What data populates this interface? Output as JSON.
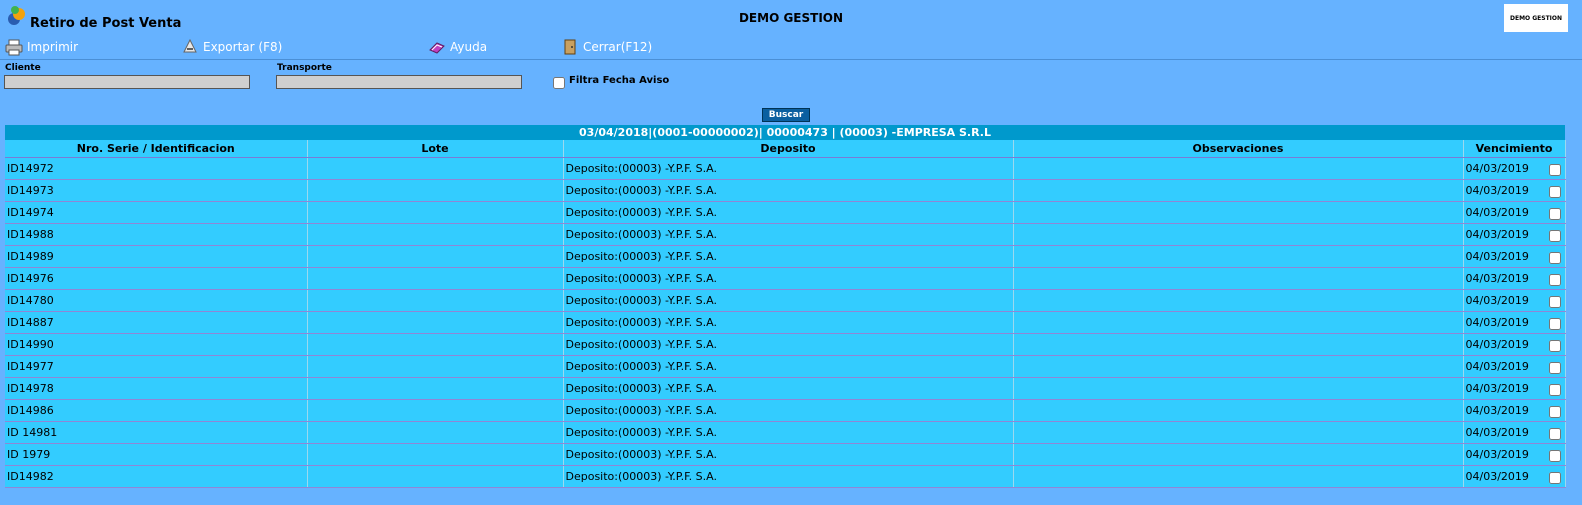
{
  "app": {
    "title": "Retiro de Post Venta",
    "center_title": "DEMO GESTION",
    "brand_label": "DEMO GESTION"
  },
  "toolbar": {
    "items": [
      {
        "label": "Imprimir",
        "icon": "printer-icon"
      },
      {
        "label": "Exportar (F8)",
        "icon": "export-icon"
      },
      {
        "label": "Ayuda",
        "icon": "help-book-icon"
      },
      {
        "label": "Cerrar(F12)",
        "icon": "close-door-icon"
      }
    ]
  },
  "filters": {
    "cliente_label": "Cliente",
    "cliente_value": "",
    "transporte_label": "Transporte",
    "transporte_value": "",
    "filtra_fecha_label": "Filtra Fecha Aviso",
    "filtra_fecha_checked": false,
    "buscar_label": "Buscar"
  },
  "group_header": "03/04/2018|(0001-00000002)| 00000473 | (00003) -EMPRESA S.R.L",
  "table": {
    "columns": [
      "Nro. Serie / Identificacion",
      "Lote",
      "Deposito",
      "Observaciones",
      "Vencimiento"
    ],
    "rows": [
      {
        "serie": "ID14972",
        "lote": "",
        "deposito": "Deposito:(00003) -Y.P.F. S.A.",
        "obs": "",
        "venc": "04/03/2019",
        "checked": false
      },
      {
        "serie": "ID14973",
        "lote": "",
        "deposito": "Deposito:(00003) -Y.P.F. S.A.",
        "obs": "",
        "venc": "04/03/2019",
        "checked": false
      },
      {
        "serie": "ID14974",
        "lote": "",
        "deposito": "Deposito:(00003) -Y.P.F. S.A.",
        "obs": "",
        "venc": "04/03/2019",
        "checked": false
      },
      {
        "serie": "ID14988",
        "lote": "",
        "deposito": "Deposito:(00003) -Y.P.F. S.A.",
        "obs": "",
        "venc": "04/03/2019",
        "checked": false
      },
      {
        "serie": "ID14989",
        "lote": "",
        "deposito": "Deposito:(00003) -Y.P.F. S.A.",
        "obs": "",
        "venc": "04/03/2019",
        "checked": false
      },
      {
        "serie": "ID14976",
        "lote": "",
        "deposito": "Deposito:(00003) -Y.P.F. S.A.",
        "obs": "",
        "venc": "04/03/2019",
        "checked": false
      },
      {
        "serie": "ID14780",
        "lote": "",
        "deposito": "Deposito:(00003) -Y.P.F. S.A.",
        "obs": "",
        "venc": "04/03/2019",
        "checked": false
      },
      {
        "serie": "ID14887",
        "lote": "",
        "deposito": "Deposito:(00003) -Y.P.F. S.A.",
        "obs": "",
        "venc": "04/03/2019",
        "checked": false
      },
      {
        "serie": "ID14990",
        "lote": "",
        "deposito": "Deposito:(00003) -Y.P.F. S.A.",
        "obs": "",
        "venc": "04/03/2019",
        "checked": false
      },
      {
        "serie": "ID14977",
        "lote": "",
        "deposito": "Deposito:(00003) -Y.P.F. S.A.",
        "obs": "",
        "venc": "04/03/2019",
        "checked": false
      },
      {
        "serie": "ID14978",
        "lote": "",
        "deposito": "Deposito:(00003) -Y.P.F. S.A.",
        "obs": "",
        "venc": "04/03/2019",
        "checked": false
      },
      {
        "serie": "ID14986",
        "lote": "",
        "deposito": "Deposito:(00003) -Y.P.F. S.A.",
        "obs": "",
        "venc": "04/03/2019",
        "checked": false
      },
      {
        "serie": "ID 14981",
        "lote": "",
        "deposito": "Deposito:(00003) -Y.P.F. S.A.",
        "obs": "",
        "venc": "04/03/2019",
        "checked": false
      },
      {
        "serie": "ID 1979",
        "lote": "",
        "deposito": "Deposito:(00003) -Y.P.F. S.A.",
        "obs": "",
        "venc": "04/03/2019",
        "checked": false
      },
      {
        "serie": "ID14982",
        "lote": "",
        "deposito": "Deposito:(00003) -Y.P.F. S.A.",
        "obs": "",
        "venc": "04/03/2019",
        "checked": false
      }
    ]
  },
  "colors": {
    "background": "#66b2ff",
    "table_bg": "#33ccff",
    "group_header_bg": "#0099cc",
    "button_bg": "#0a5fa0"
  }
}
